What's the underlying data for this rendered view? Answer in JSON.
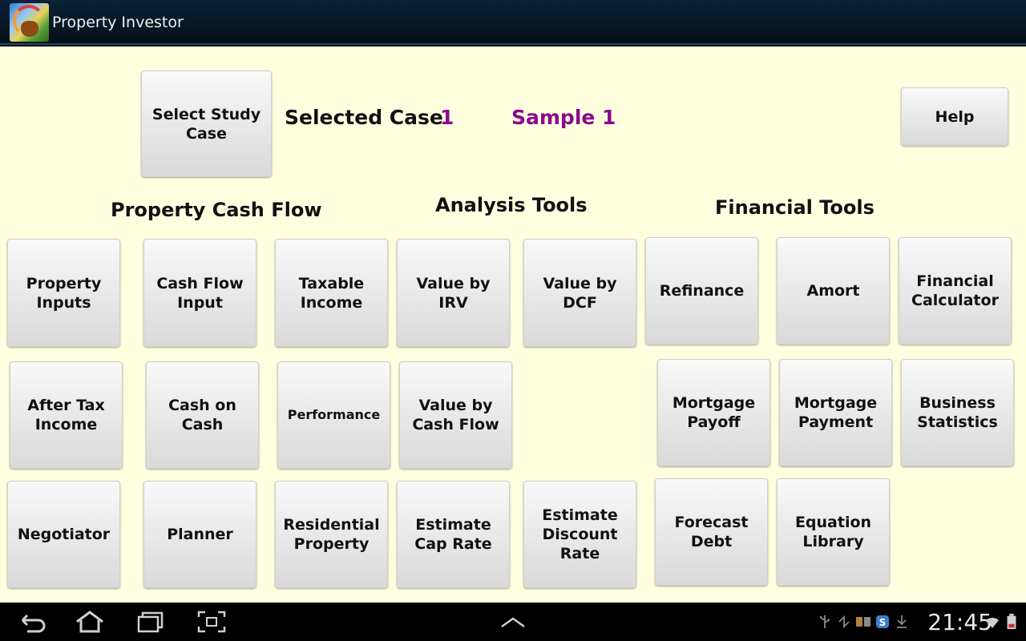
{
  "app": {
    "title": "Property Investor"
  },
  "header": {
    "select_case_label": "Select Study Case",
    "selected_case_label": "Selected Case",
    "case_number": "1",
    "case_name": "Sample 1",
    "help_label": "Help"
  },
  "sections": {
    "property_cash_flow": "Property Cash Flow",
    "analysis_tools": "Analysis Tools",
    "financial_tools": "Financial Tools"
  },
  "buttons": {
    "property_inputs": "Property Inputs",
    "cash_flow_input": "Cash Flow Input",
    "taxable_income": "Taxable Income",
    "value_by_irv": "Value by IRV",
    "value_by_dcf": "Value by DCF",
    "refinance": "Refinance",
    "amort": "Amort",
    "financial_calculator": "Financial Calculator",
    "after_tax_income": "After Tax Income",
    "cash_on_cash": "Cash on Cash",
    "performance": "Performance",
    "value_by_cash_flow": "Value by Cash Flow",
    "mortgage_payoff": "Mortgage Payoff",
    "mortgage_payment": "Mortgage Payment",
    "business_statistics": "Business Statistics",
    "negotiator": "Negotiator",
    "planner": "Planner",
    "residential_property": "Residential Property",
    "estimate_cap_rate": "Estimate Cap Rate",
    "estimate_discount_rate": "Estimate Discount Rate",
    "forecast_debt": "Forecast Debt",
    "equation_library": "Equation Library"
  },
  "status_bar": {
    "time": "21:45"
  },
  "icons": {
    "back": "back-icon",
    "home": "home-icon",
    "recents": "recent-apps-icon",
    "screenshot": "screenshot-icon",
    "expand": "chevron-up-icon",
    "usb": "usb-icon",
    "sync": "sync-icon",
    "wifi": "wifi-icon",
    "battery": "battery-icon"
  },
  "colors": {
    "background": "#ffffe0",
    "accent": "#8a0a8a",
    "button_top": "#f9f9f9",
    "button_bottom": "#d9d9d9"
  }
}
